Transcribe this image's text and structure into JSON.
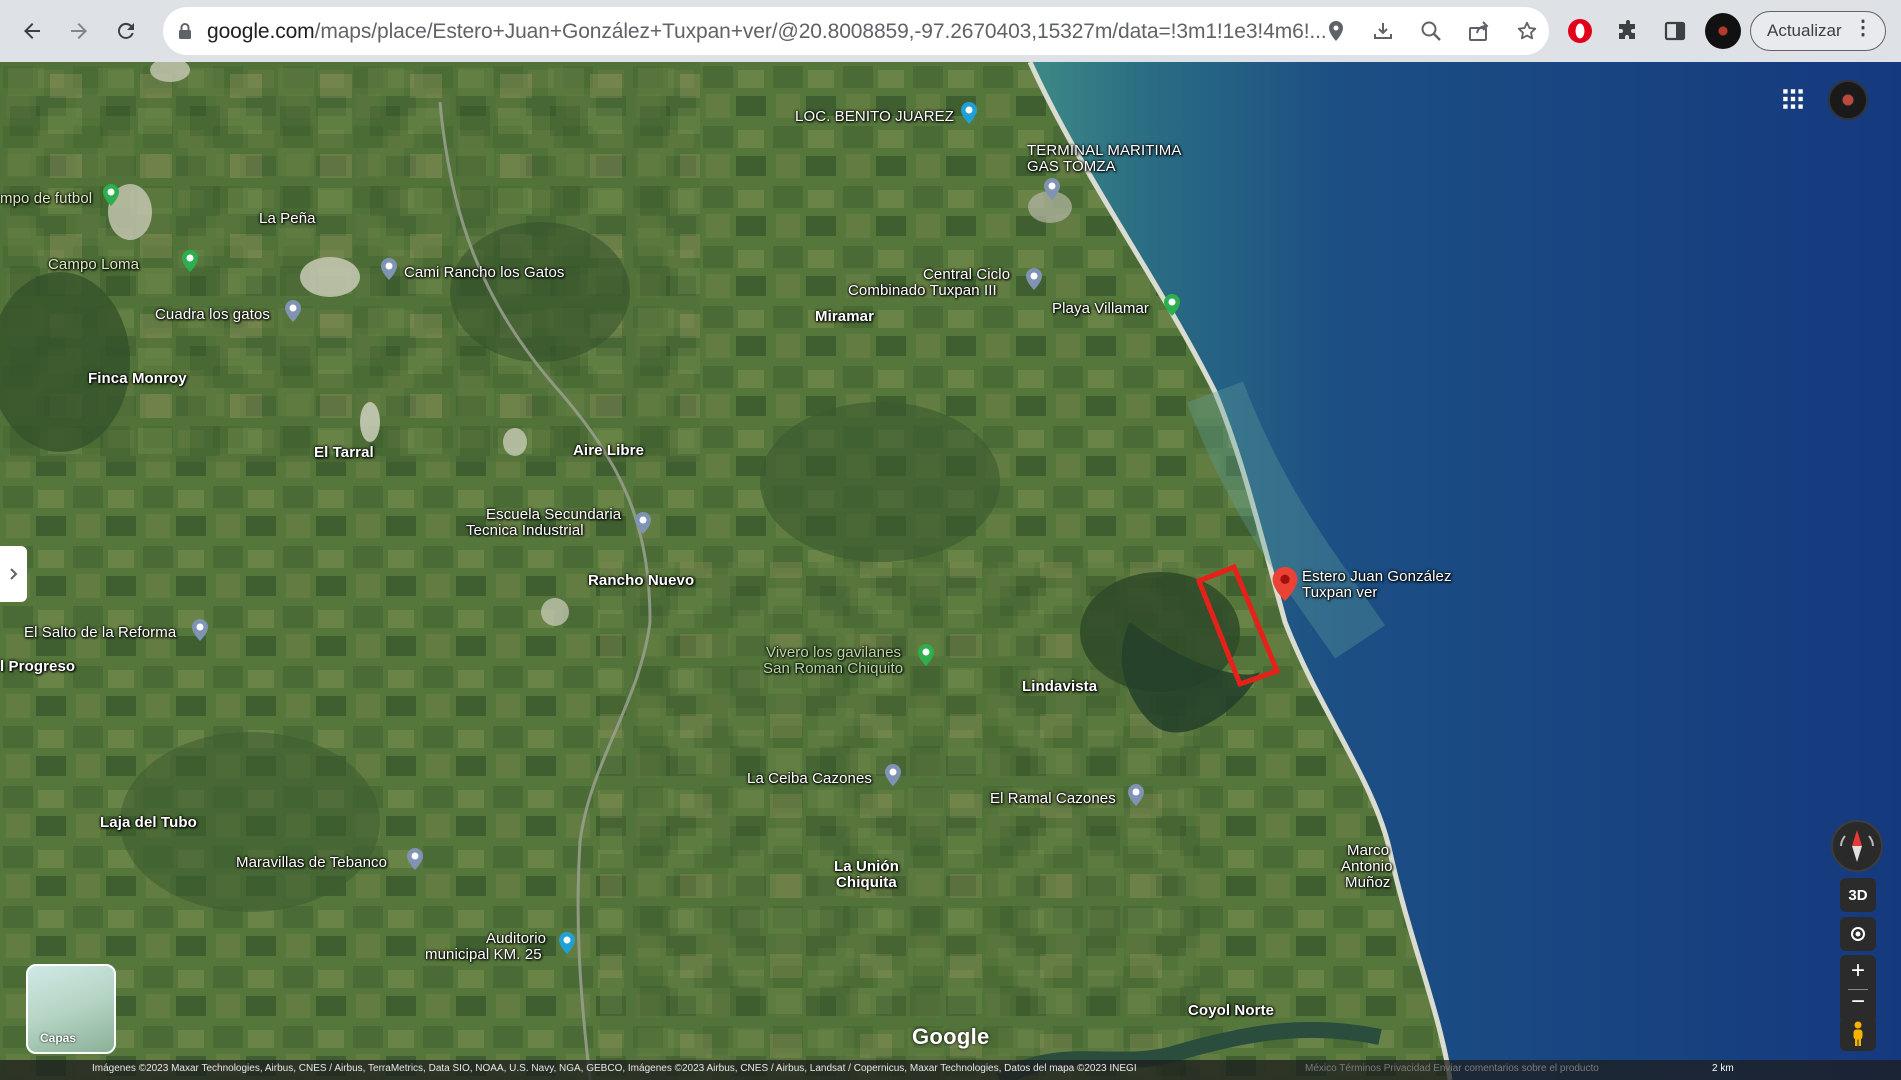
{
  "browser": {
    "url_host": "google.com",
    "url_path": "/maps/place/Estero+Juan+González+Tuxpan+ver/@20.8008859,-97.2670403,15327m/data=!3m1!1e3!4m6!...",
    "update_label": "Actualizar"
  },
  "map": {
    "places": [
      {
        "label": "LOC. BENITO JUAREZ"
      },
      {
        "label": "TERMINAL MARITIMA"
      },
      {
        "label": "GAS TOMZA"
      },
      {
        "label": "La Peña"
      },
      {
        "label": "mpo de futbol"
      },
      {
        "label": "Campo Loma"
      },
      {
        "label": "Cami Rancho los Gatos"
      },
      {
        "label": "Cuadra los gatos"
      },
      {
        "label": "Central Ciclo"
      },
      {
        "label": "Combinado Tuxpan III"
      },
      {
        "label": "Miramar"
      },
      {
        "label": "Playa Villamar"
      },
      {
        "label": "Finca Monroy"
      },
      {
        "label": "El Tarral"
      },
      {
        "label": "Aire Libre"
      },
      {
        "label": "Escuela Secundaria"
      },
      {
        "label": "Tecnica Industrial"
      },
      {
        "label": "Rancho Nuevo"
      },
      {
        "label": "El Salto de la Reforma"
      },
      {
        "label": "l Progreso"
      },
      {
        "label": "Vivero los gavilanes"
      },
      {
        "label": "San Roman Chiquito"
      },
      {
        "label": "Lindavista"
      },
      {
        "label": "La Ceiba Cazones"
      },
      {
        "label": "El Ramal Cazones"
      },
      {
        "label": "Laja del Tubo"
      },
      {
        "label": "Maravillas de Tebanco"
      },
      {
        "label": "La Unión"
      },
      {
        "label": "Chiquita"
      },
      {
        "label": "Marco"
      },
      {
        "label": "Antonio"
      },
      {
        "label": "Muñoz"
      },
      {
        "label": "Auditorio"
      },
      {
        "label": "municipal KM. 25"
      },
      {
        "label": "Coyol Norte"
      }
    ],
    "selected_place": {
      "line1": "Estero Juan González",
      "line2": "Tuxpan ver"
    },
    "highlight_color": "#e8201a",
    "layers_label": "Capas",
    "view_3d_label": "3D",
    "zoom_in": "+",
    "zoom_out": "−",
    "logo": "Google",
    "attribution": "Imágenes ©2023 Maxar Technologies, Airbus, CNES / Airbus, TerraMetrics, Data SIO, NOAA, U.S. Navy, NGA, GEBCO, Imágenes ©2023 Airbus, CNES / Airbus, Landsat / Copernicus, Maxar Technologies, Datos del mapa ©2023 INEGI",
    "footer_links": "México    Términos    Privacidad    Enviar comentarios sobre el producto",
    "scale": "2 km"
  },
  "icons": [
    "back-icon",
    "forward-icon",
    "reload-icon",
    "lock-icon",
    "location-icon",
    "install-icon",
    "zoom-icon",
    "share-icon",
    "star-icon",
    "opera-icon",
    "extensions-icon",
    "side-panel-icon",
    "profile-avatar",
    "apps-grid-icon",
    "compass-icon",
    "pegman-icon"
  ]
}
